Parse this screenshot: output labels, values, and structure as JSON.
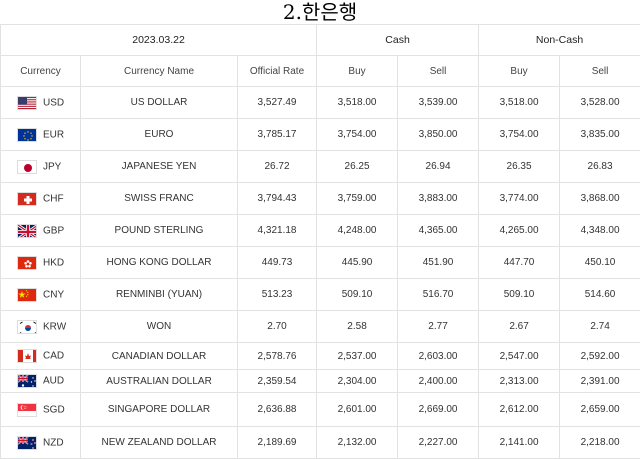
{
  "title": "2.한은행",
  "date": "2023.03.22",
  "groups": {
    "cash": "Cash",
    "non_cash": "Non-Cash"
  },
  "columns": {
    "currency": "Currency",
    "name": "Currency Name",
    "official": "Official Rate",
    "cash_buy": "Buy",
    "cash_sell": "Sell",
    "nc_buy": "Buy",
    "nc_sell": "Sell"
  },
  "rows": [
    {
      "code": "USD",
      "name": "US DOLLAR",
      "official": "3,527.49",
      "cash_buy": "3,518.00",
      "cash_sell": "3,539.00",
      "nc_buy": "3,518.00",
      "nc_sell": "3,528.00",
      "flag": "us-flag-icon"
    },
    {
      "code": "EUR",
      "name": "EURO",
      "official": "3,785.17",
      "cash_buy": "3,754.00",
      "cash_sell": "3,850.00",
      "nc_buy": "3,754.00",
      "nc_sell": "3,835.00",
      "flag": "eu-flag-icon"
    },
    {
      "code": "JPY",
      "name": "JAPANESE YEN",
      "official": "26.72",
      "cash_buy": "26.25",
      "cash_sell": "26.94",
      "nc_buy": "26.35",
      "nc_sell": "26.83",
      "flag": "jp-flag-icon"
    },
    {
      "code": "CHF",
      "name": "SWISS FRANC",
      "official": "3,794.43",
      "cash_buy": "3,759.00",
      "cash_sell": "3,883.00",
      "nc_buy": "3,774.00",
      "nc_sell": "3,868.00",
      "flag": "ch-flag-icon"
    },
    {
      "code": "GBP",
      "name": "POUND STERLING",
      "official": "4,321.18",
      "cash_buy": "4,248.00",
      "cash_sell": "4,365.00",
      "nc_buy": "4,265.00",
      "nc_sell": "4,348.00",
      "flag": "gb-flag-icon"
    },
    {
      "code": "HKD",
      "name": "HONG KONG DOLLAR",
      "official": "449.73",
      "cash_buy": "445.90",
      "cash_sell": "451.90",
      "nc_buy": "447.70",
      "nc_sell": "450.10",
      "flag": "hk-flag-icon"
    },
    {
      "code": "CNY",
      "name": "RENMINBI (YUAN)",
      "official": "513.23",
      "cash_buy": "509.10",
      "cash_sell": "516.70",
      "nc_buy": "509.10",
      "nc_sell": "514.60",
      "flag": "cn-flag-icon"
    },
    {
      "code": "KRW",
      "name": "WON",
      "official": "2.70",
      "cash_buy": "2.58",
      "cash_sell": "2.77",
      "nc_buy": "2.67",
      "nc_sell": "2.74",
      "flag": "kr-flag-icon"
    },
    {
      "code": "CAD",
      "name": "CANADIAN DOLLAR",
      "official": "2,578.76",
      "cash_buy": "2,537.00",
      "cash_sell": "2,603.00",
      "nc_buy": "2,547.00",
      "nc_sell": "2,592.00",
      "flag": "ca-flag-icon"
    },
    {
      "code": "AUD",
      "name": "AUSTRALIAN DOLLAR",
      "official": "2,359.54",
      "cash_buy": "2,304.00",
      "cash_sell": "2,400.00",
      "nc_buy": "2,313.00",
      "nc_sell": "2,391.00",
      "flag": "au-flag-icon"
    },
    {
      "code": "SGD",
      "name": "SINGAPORE DOLLAR",
      "official": "2,636.88",
      "cash_buy": "2,601.00",
      "cash_sell": "2,669.00",
      "nc_buy": "2,612.00",
      "nc_sell": "2,659.00",
      "flag": "sg-flag-icon"
    },
    {
      "code": "NZD",
      "name": "NEW ZEALAND DOLLAR",
      "official": "2,189.69",
      "cash_buy": "2,132.00",
      "cash_sell": "2,227.00",
      "nc_buy": "2,141.00",
      "nc_sell": "2,218.00",
      "flag": "nz-flag-icon"
    }
  ]
}
